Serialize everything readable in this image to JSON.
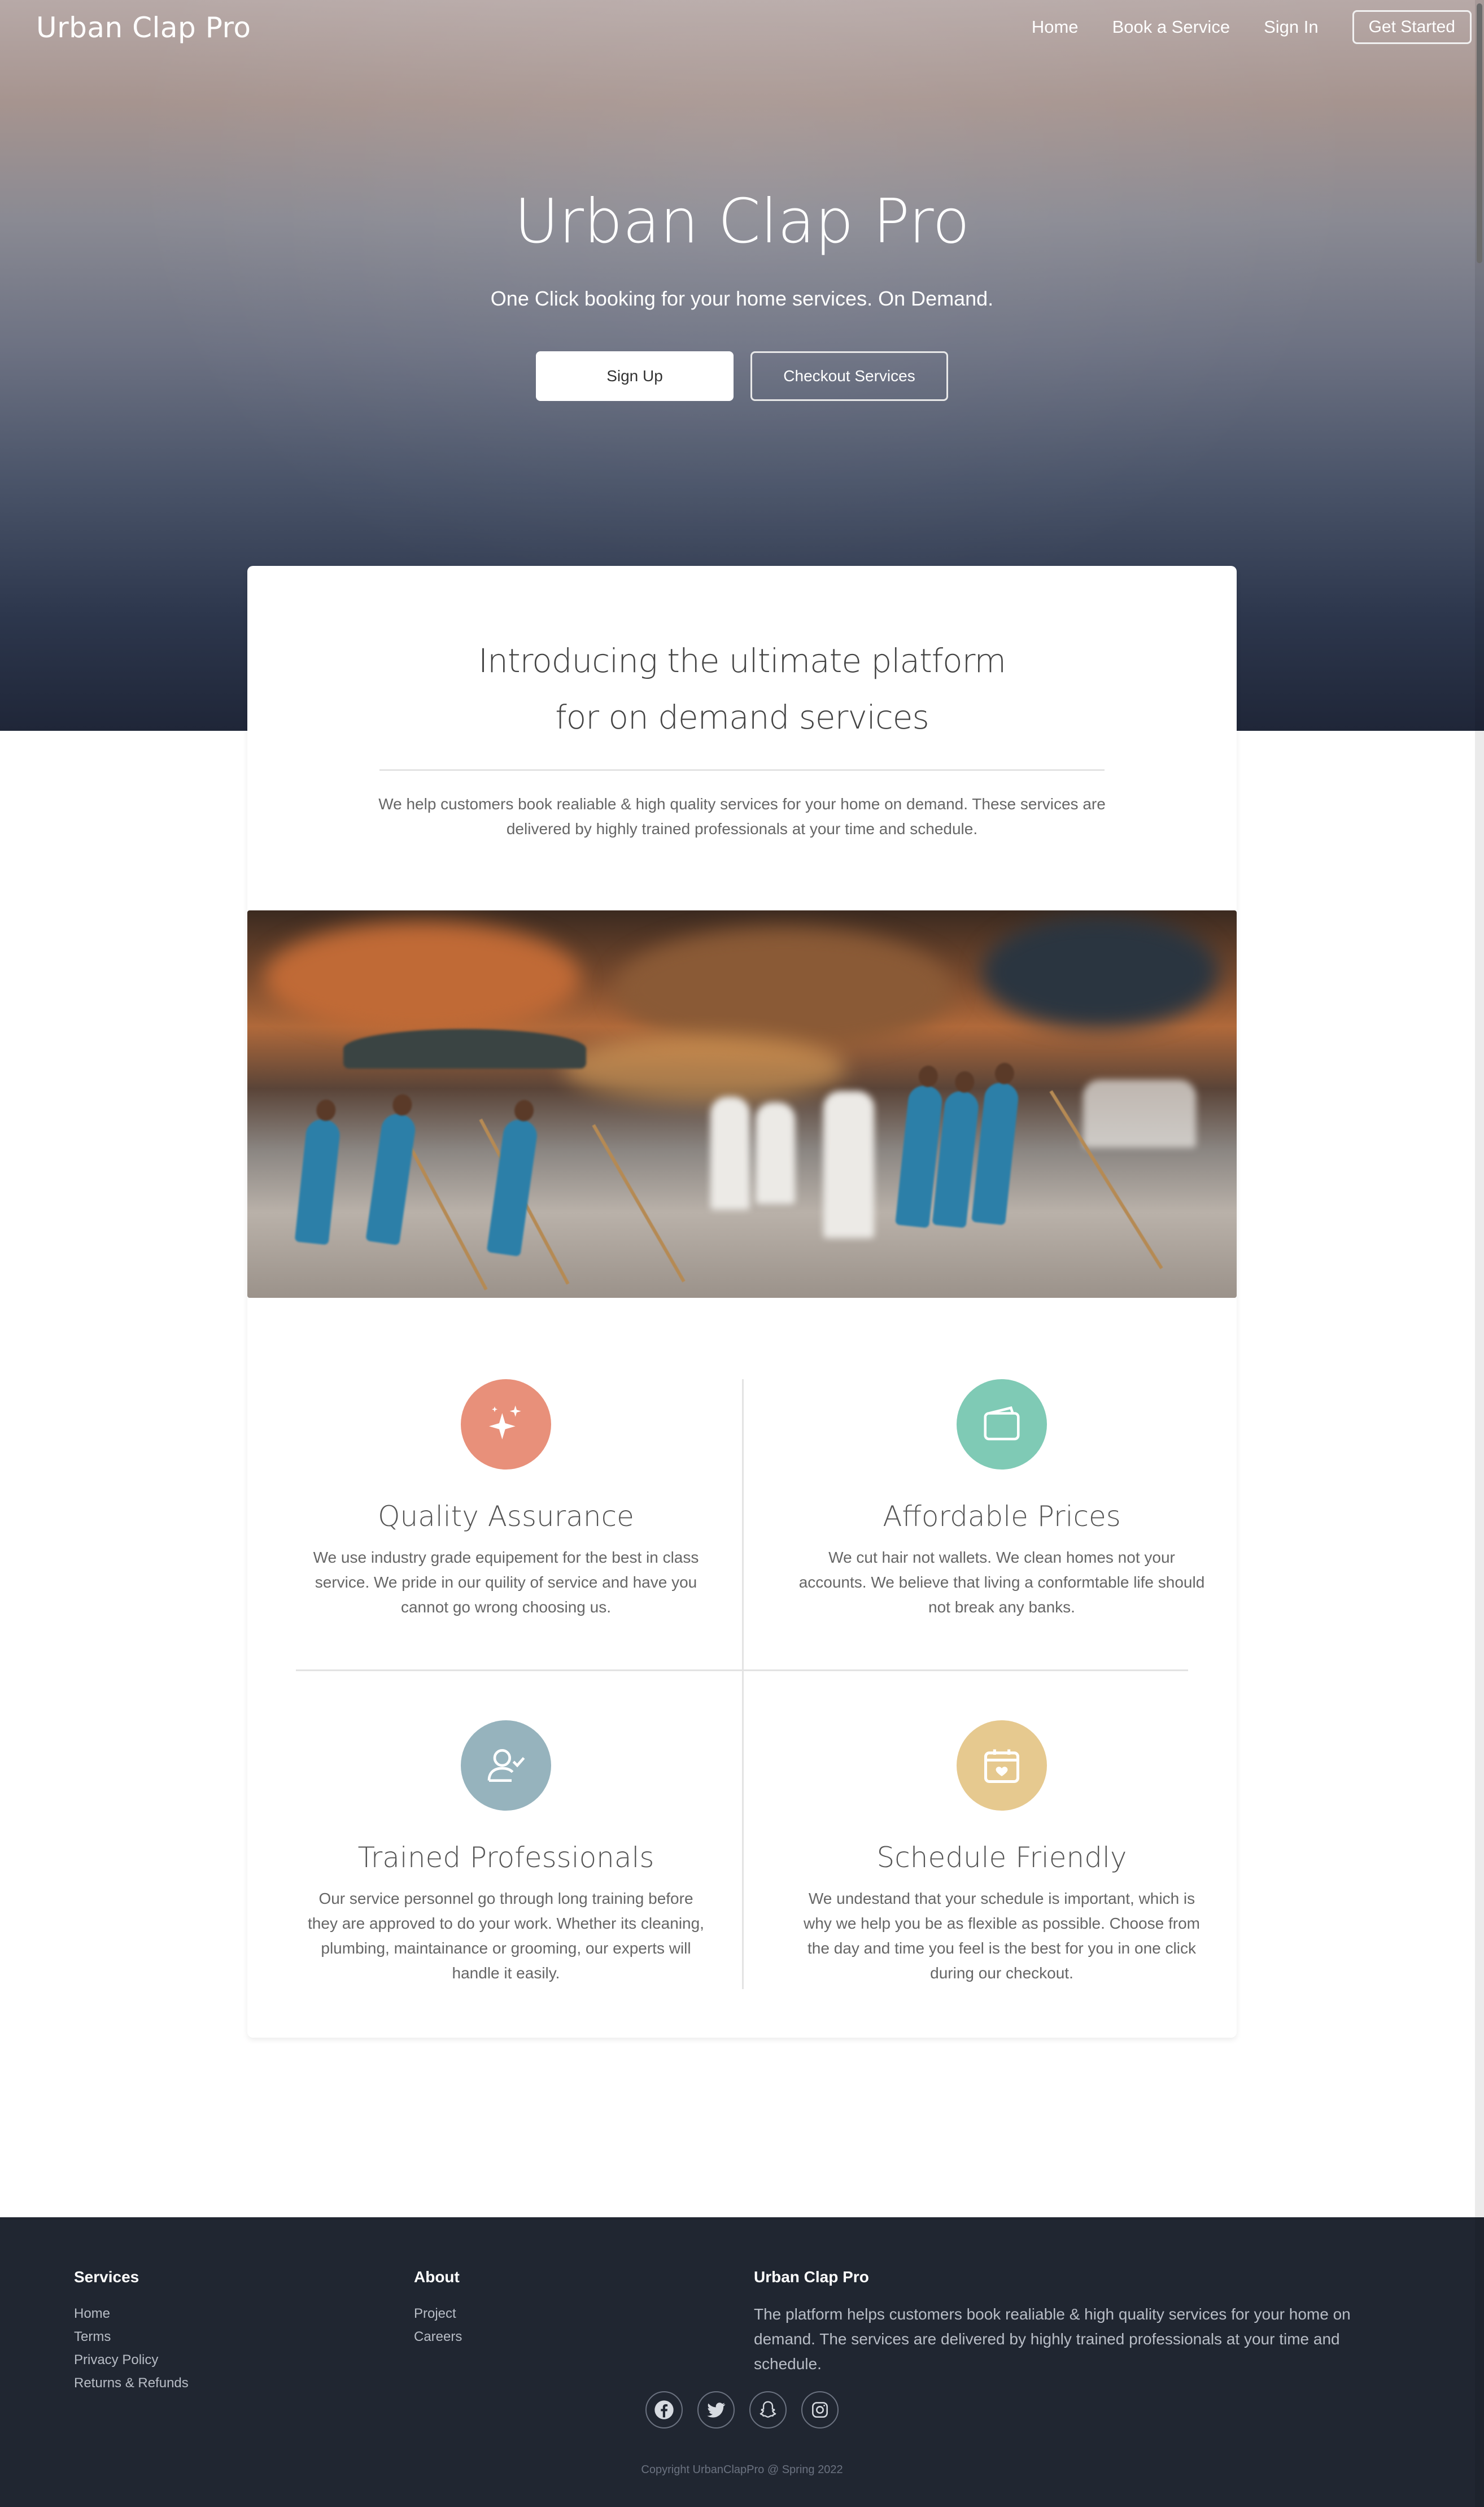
{
  "header": {
    "brand": "Urban Clap Pro",
    "nav": [
      "Home",
      "Book a Service",
      "Sign In"
    ],
    "cta": "Get Started"
  },
  "hero": {
    "title": "Urban Clap Pro",
    "subtitle": "One Click booking for your home services. On Demand.",
    "primary_button": "Sign Up",
    "secondary_button": "Checkout Services"
  },
  "intro": {
    "title_line1": "Introducing the ultimate platform",
    "title_line2": "for on demand services",
    "text": "We help customers book realiable & high quality services for your home on demand. These services are delivered by highly trained professionals at your time and schedule."
  },
  "features": [
    {
      "icon": "sparkles-icon",
      "color": "#e8907a",
      "title": "Quality Assurance",
      "text": "We use industry grade equipement for the best in class service. We pride in our quility of service and have you cannot go wrong choosing us."
    },
    {
      "icon": "wallet-icon",
      "color": "#7fcab5",
      "title": "Affordable Prices",
      "text": "We cut hair not wallets. We clean homes not your accounts. We believe that living a conformtable life should not break any banks."
    },
    {
      "icon": "user-check-icon",
      "color": "#96b3bd",
      "title": "Trained Professionals",
      "text": "Our service personnel go through long training before they are approved to do your work. Whether its cleaning, plumbing, maintainance or grooming, our experts will handle it easily."
    },
    {
      "icon": "calendar-heart-icon",
      "color": "#e6c98f",
      "title": "Schedule Friendly",
      "text": "We undestand that your schedule is important, which is why we help you be as flexible as possible. Choose from the day and time you feel is the best for you in one click during our checkout."
    }
  ],
  "footer": {
    "services_title": "Services",
    "services_links": [
      "Home",
      "Terms",
      "Privacy Policy",
      "Returns & Refunds"
    ],
    "about_title": "About",
    "about_links": [
      "Project",
      "Careers"
    ],
    "brand_title": "Urban Clap Pro",
    "brand_text": "The platform helps customers book realiable & high quality services for your home on demand. The services are delivered by highly trained professionals at your time and schedule.",
    "socials": [
      "facebook-icon",
      "twitter-icon",
      "snapchat-icon",
      "instagram-icon"
    ],
    "copyright": "Copyright UrbanClapPro @ Spring 2022"
  }
}
